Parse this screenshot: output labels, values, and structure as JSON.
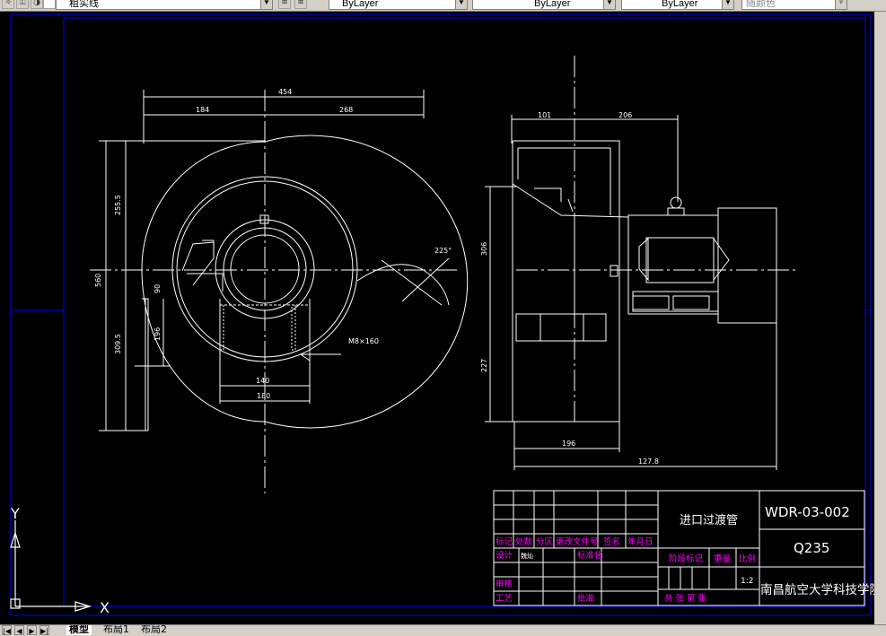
{
  "toolbar": {
    "layer_name": "粗实线",
    "color": "ByLayer",
    "linetype": "ByLayer",
    "lineweight": "ByLayer",
    "plotstyle": "随颜色"
  },
  "dimensions": {
    "top_total": "454",
    "top_left": "184",
    "top_right": "268",
    "left_total": "560",
    "left_upper": "255.5",
    "left_lower": "309.5",
    "inlet_90": "90",
    "inlet_196": "196",
    "bottom_140": "140",
    "bottom_180": "180",
    "bolt": "M8×160",
    "angle": "225°",
    "side_101": "101",
    "side_206": "206",
    "side_306": "306",
    "side_227": "227",
    "side_196": "196",
    "side_1278": "127.8"
  },
  "title_block": {
    "part_name": "进口过渡管",
    "drawing_no": "WDR-03-002",
    "material": "Q235",
    "school": "南昌航空大学科技学院",
    "scale": "1:2",
    "hdr_mark": "标记",
    "hdr_count": "处数",
    "hdr_zone": "分区",
    "hdr_change_doc": "更改文件号",
    "hdr_sign": "签名",
    "hdr_date": "年月日",
    "design": "设计",
    "designer": "魏灿",
    "standardize": "标准化",
    "stage_mark": "阶段标记",
    "weight": "重量",
    "ratio": "比例",
    "check": "审核",
    "process": "工艺",
    "approve": "批准",
    "sheets": "共  张  第  张"
  },
  "ucs": {
    "y": "Y",
    "x": "X"
  },
  "tabs": {
    "model": "模型",
    "layout1": "布局1",
    "layout2": "布局2"
  },
  "colors": {
    "frame": "#0000ff",
    "line": "#ffffff",
    "tb_label": "#ff00ff"
  }
}
